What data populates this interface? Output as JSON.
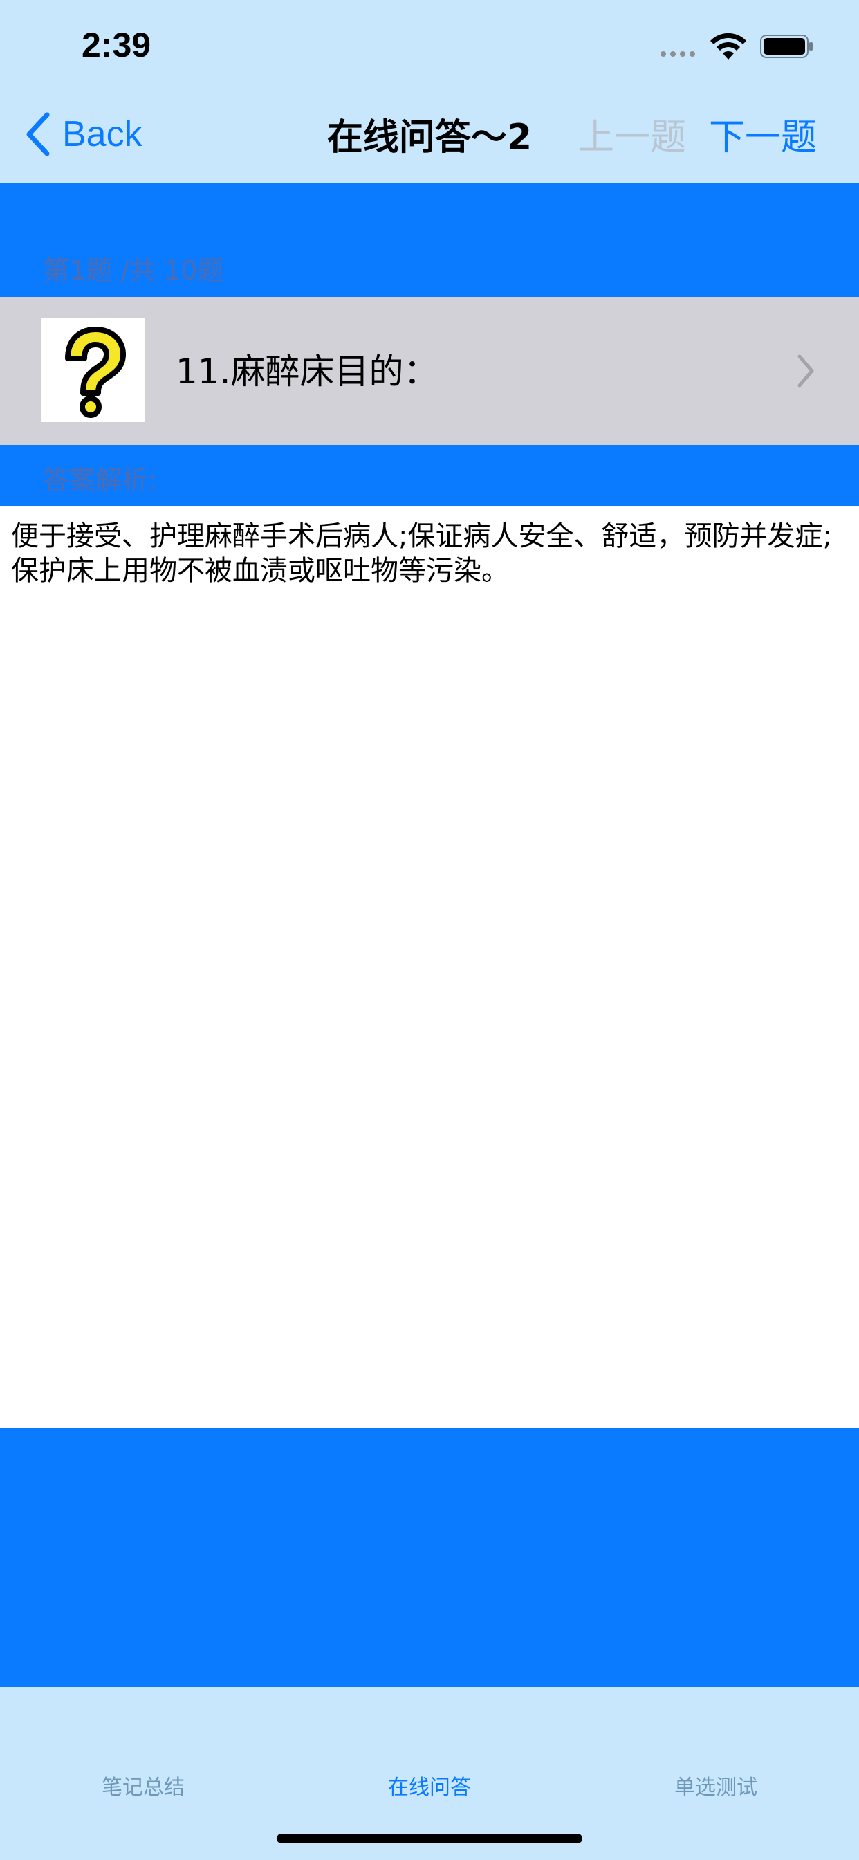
{
  "status_bar": {
    "time": "2:39"
  },
  "nav": {
    "back_label": "Back",
    "title": "在线问答～2",
    "prev_label": "上一题",
    "next_label": "下一题"
  },
  "question": {
    "counter": "第1题 /共 10题",
    "text": "11.麻醉床目的：",
    "icon": "question-mark-icon"
  },
  "answer": {
    "label": "答案解析:",
    "text": "便于接受、护理麻醉手术后病人;保证病人安全、舒适，预防并发症;保护床上用物不被血渍或呕吐物等污染。"
  },
  "tabs": [
    {
      "label": "笔记总结",
      "active": false
    },
    {
      "label": "在线问答",
      "active": true
    },
    {
      "label": "单选测试",
      "active": false
    }
  ],
  "colors": {
    "accent": "#0a7aff",
    "nav_background": "#c8e7fd",
    "row_background": "#d2d1d7",
    "disabled_text": "#b9c6d2"
  }
}
